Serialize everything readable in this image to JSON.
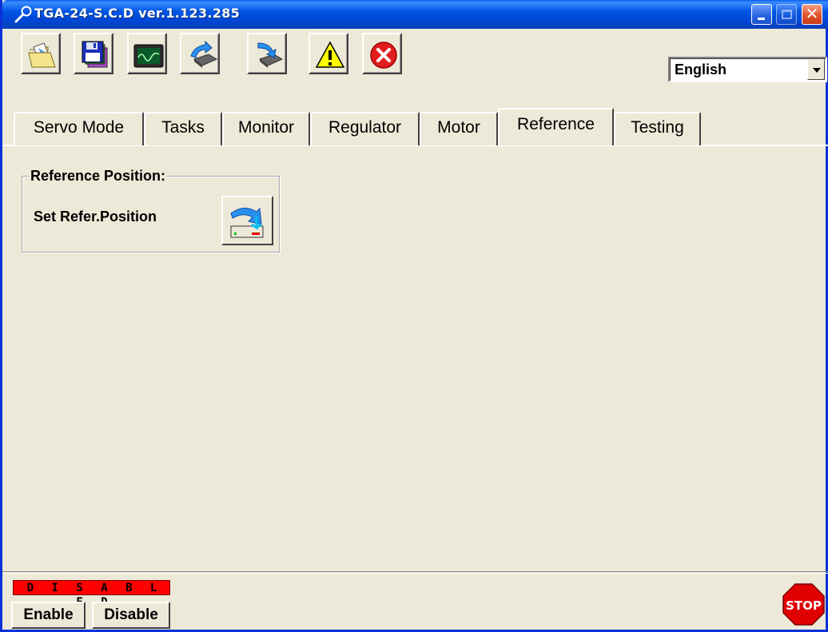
{
  "window": {
    "title": "TGA-24-S.C.D  ver.1.123.285",
    "controls": {
      "minimize": "minimize",
      "maximize": "maximize",
      "close": "close"
    }
  },
  "toolbar": {
    "buttons": [
      {
        "name": "open",
        "icon": "open-folder-icon"
      },
      {
        "name": "save",
        "icon": "floppy-disk-icon"
      },
      {
        "name": "monitor",
        "icon": "oscilloscope-monitor-icon"
      },
      {
        "name": "upload",
        "icon": "upload-to-device-icon"
      },
      {
        "name": "download",
        "icon": "download-from-device-icon"
      },
      {
        "name": "warning",
        "icon": "warning-icon"
      },
      {
        "name": "error",
        "icon": "error-icon"
      }
    ],
    "language": {
      "selected": "English"
    }
  },
  "tabs": [
    {
      "label": "Servo Mode",
      "active": false
    },
    {
      "label": "Tasks",
      "active": false
    },
    {
      "label": "Monitor",
      "active": false
    },
    {
      "label": "Regulator",
      "active": false
    },
    {
      "label": "Motor",
      "active": false
    },
    {
      "label": "Reference",
      "active": true
    },
    {
      "label": "Testing",
      "active": false
    }
  ],
  "reference_panel": {
    "group_label": "Reference Position:",
    "set_label": "Set Refer.Position",
    "set_button_icon": "set-reference-arrow-icon"
  },
  "status": {
    "drive_state": "D I S A B L E D",
    "drive_state_color": "#ff0000",
    "enable_label": "Enable",
    "disable_label": "Disable",
    "stop_label": "STOP"
  },
  "colors": {
    "titlebar": "#0055e5",
    "background": "#ece9d8",
    "stop_sign": "#e00000"
  }
}
